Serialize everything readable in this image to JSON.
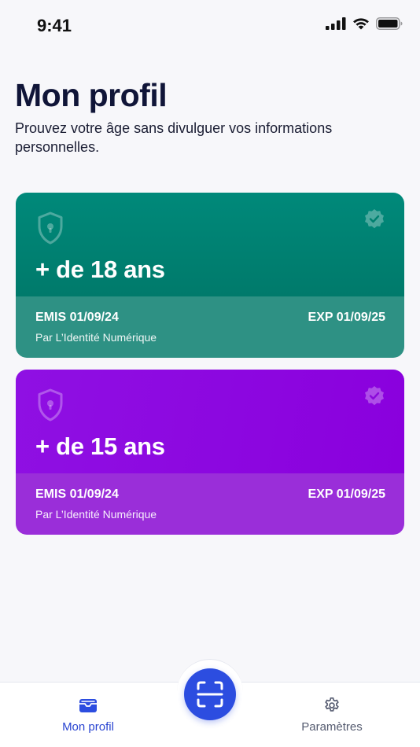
{
  "status_bar": {
    "time": "9:41"
  },
  "header": {
    "title": "Mon profil",
    "subtitle": "Prouvez votre âge sans divulguer vos informations personnelles."
  },
  "cards": [
    {
      "age": "+ de 18 ans",
      "issued": "EMIS 01/09/24",
      "expiry": "EXP 01/09/25",
      "issuer": "Par L’Identité Numérique",
      "color": "#00897a"
    },
    {
      "age": "+ de 15 ans",
      "issued": "EMIS 01/09/24",
      "expiry": "EXP 01/09/25",
      "issuer": "Par L’Identité Numérique",
      "color": "#8f10e3"
    }
  ],
  "tab_bar": {
    "profile_label": "Mon profil",
    "settings_label": "Paramètres",
    "active": "profile",
    "accent": "#2c4de0"
  }
}
